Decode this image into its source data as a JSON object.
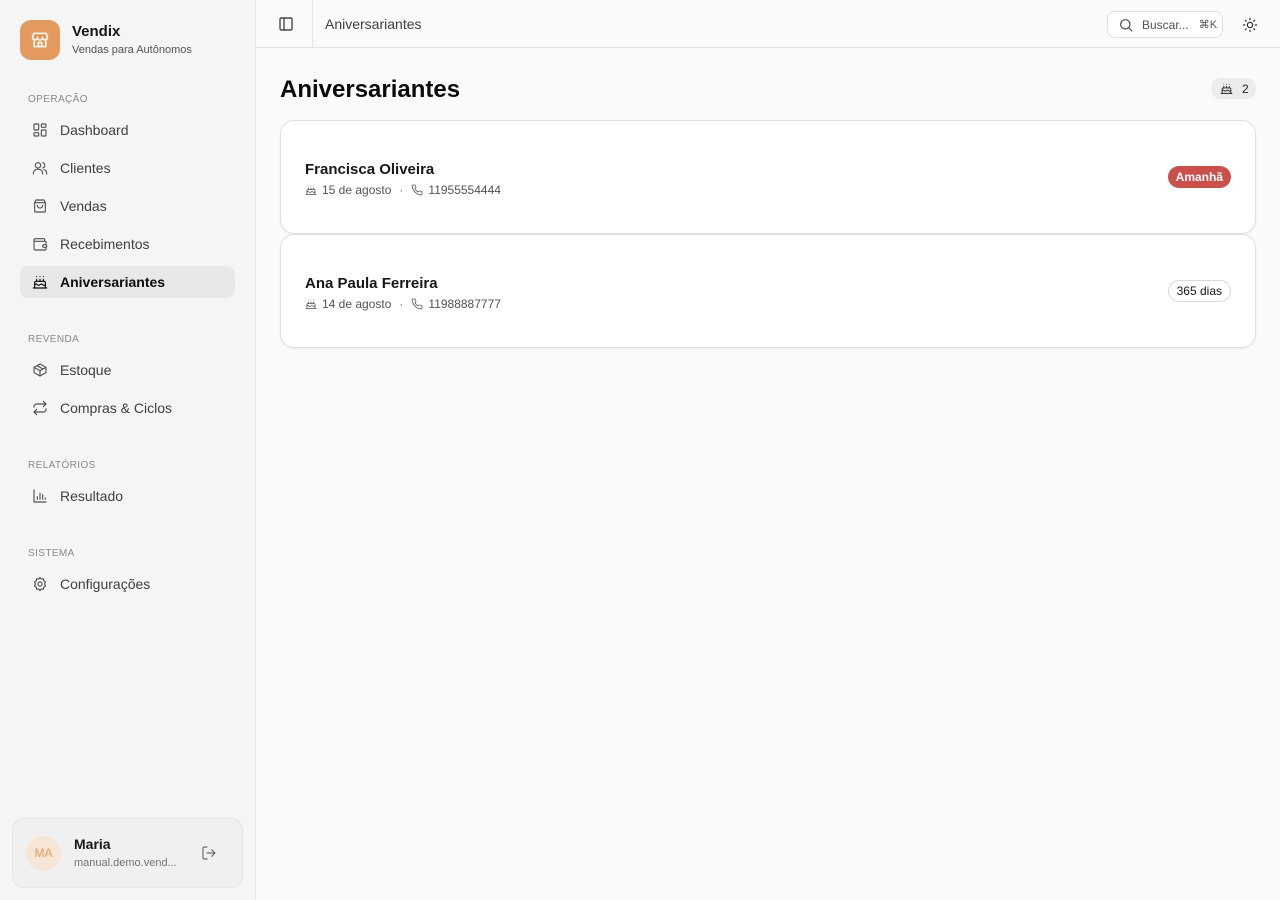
{
  "brand": {
    "name": "Vendix",
    "subtitle": "Vendas para Autônomos",
    "icon": "store-icon",
    "color": "#e39a5c"
  },
  "sidebar": {
    "sections": [
      {
        "label": "OPERAÇÃO",
        "items": [
          {
            "label": "Dashboard",
            "icon": "dashboard-icon"
          },
          {
            "label": "Clientes",
            "icon": "users-icon"
          },
          {
            "label": "Vendas",
            "icon": "shopping-bag-icon"
          },
          {
            "label": "Recebimentos",
            "icon": "wallet-icon"
          },
          {
            "label": "Aniversariantes",
            "icon": "cake-icon",
            "active": true
          }
        ]
      },
      {
        "label": "REVENDA",
        "items": [
          {
            "label": "Estoque",
            "icon": "package-icon"
          },
          {
            "label": "Compras & Ciclos",
            "icon": "repeat-icon"
          }
        ]
      },
      {
        "label": "RELATÓRIOS",
        "items": [
          {
            "label": "Resultado",
            "icon": "bar-chart-icon"
          }
        ]
      },
      {
        "label": "SISTEMA",
        "items": [
          {
            "label": "Configurações",
            "icon": "gear-icon"
          }
        ]
      }
    ]
  },
  "user": {
    "initials": "MA",
    "name": "Maria",
    "email": "manual.demo.vend..."
  },
  "header": {
    "title": "Aniversariantes",
    "search_placeholder": "Buscar...",
    "search_shortcut": "⌘K"
  },
  "main": {
    "title": "Aniversariantes",
    "count": "2",
    "birthdays": [
      {
        "name": "Francisca Oliveira",
        "date": "15 de agosto",
        "phone": "11955554444",
        "badge": "Amanhã",
        "badge_style": "urgent",
        "badge_color": "#cc4f4a"
      },
      {
        "name": "Ana Paula Ferreira",
        "date": "14 de agosto",
        "phone": "11988887777",
        "badge": "365 dias",
        "badge_style": "outline"
      }
    ]
  }
}
